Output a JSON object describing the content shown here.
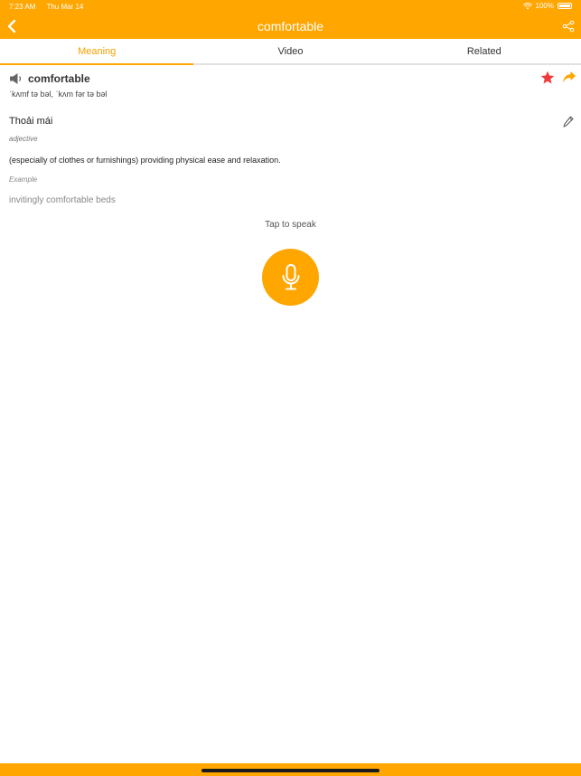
{
  "status_bar": {
    "time": "7:23 AM",
    "date": "Thu Mar 14",
    "battery": "100%"
  },
  "header": {
    "title": "comfortable",
    "accent_color": "#FFA600"
  },
  "tabs": [
    {
      "label": "Meaning",
      "active": true
    },
    {
      "label": "Video",
      "active": false
    },
    {
      "label": "Related",
      "active": false
    }
  ],
  "entry": {
    "word": "comfortable",
    "phonetic": "ˈkʌmf tə bəl, ˈkʌm fər tə bəl",
    "meaning": "Thoải mái",
    "part_of_speech": "adjective",
    "definition": "(especially of clothes or furnishings) providing physical ease and relaxation.",
    "example_label": "Example",
    "example": "invitingly comfortable beds"
  },
  "speak": {
    "label": "Tap to speak"
  },
  "icons": {
    "back": "chevron-left-icon",
    "share": "share-icon",
    "speaker": "speaker-icon",
    "favorite": "star-icon",
    "forward": "forward-arrow-icon",
    "edit": "pencil-icon",
    "mic": "microphone-icon",
    "wifi": "wifi-icon",
    "battery": "battery-icon"
  },
  "colors": {
    "accent": "#FFA600",
    "star": "#F03A3A",
    "active_tab_text": "#F5A200"
  }
}
